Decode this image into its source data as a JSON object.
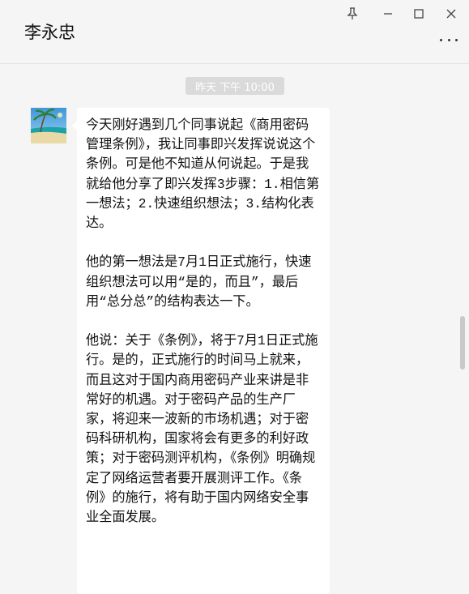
{
  "window": {
    "title": "李永忠",
    "controls": [
      "pin-icon",
      "minimize-icon",
      "maximize-icon",
      "close-icon"
    ],
    "more_icon": "more-icon"
  },
  "chat": {
    "timestamp": "昨天 下午 10:00",
    "messages": [
      {
        "sender_avatar": "beach-avatar",
        "text": "今天刚好遇到几个同事说起《商用密码管理条例》，我让同事即兴发挥说说这个条例。可是他不知道从何说起。于是我就给他分享了即兴发挥3步骤：1.相信第一想法；2.快速组织想法；3.结构化表达。\n\n他的第一想法是7月1日正式施行，快速组织想法可以用“是的，而且”，最后用“总分总”的结构表达一下。\n\n他说：关于《条例》，将于7月1日正式施行。是的，正式施行的时间马上就来，而且这对于国内商用密码产业来讲是非常好的机遇。对于密码产品的生产厂家，将迎来一波新的市场机遇；对于密码科研机构，国家将会有更多的利好政策；对于密码测评机构，《条例》明确规定了网络运营者要开展测评工作。《条例》的施行，将有助于国内网络安全事业全面发展。"
      }
    ]
  },
  "colors": {
    "background": "#f5f5f5",
    "bubble": "#ffffff",
    "timestamp_bg": "#dadada"
  }
}
